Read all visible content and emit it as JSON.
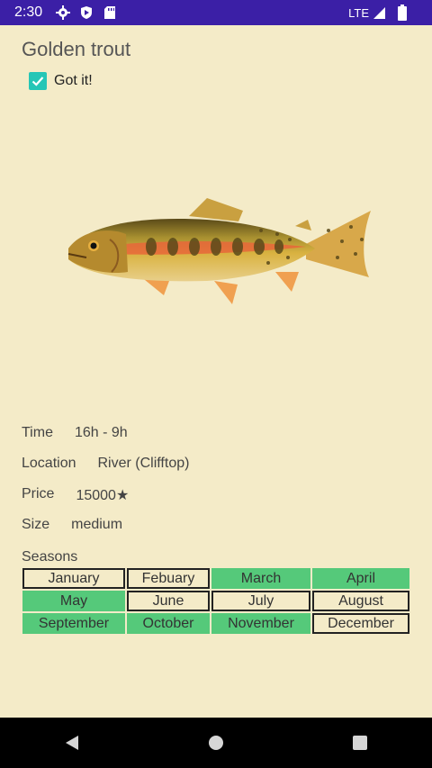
{
  "status_bar": {
    "time": "2:30",
    "network": "LTE"
  },
  "page": {
    "title": "Golden trout",
    "caught_label": "Got it!",
    "caught": true
  },
  "info": {
    "time_label": "Time",
    "time_value": "16h - 9h",
    "location_label": "Location",
    "location_value": "River (Clifftop)",
    "price_label": "Price",
    "price_value": "15000★",
    "size_label": "Size",
    "size_value": "medium"
  },
  "seasons": {
    "label": "Seasons",
    "months": [
      {
        "name": "January",
        "active": false
      },
      {
        "name": "Febuary",
        "active": false
      },
      {
        "name": "March",
        "active": true
      },
      {
        "name": "April",
        "active": true
      },
      {
        "name": "May",
        "active": true
      },
      {
        "name": "June",
        "active": false
      },
      {
        "name": "July",
        "active": false
      },
      {
        "name": "August",
        "active": false
      },
      {
        "name": "September",
        "active": true
      },
      {
        "name": "October",
        "active": true
      },
      {
        "name": "November",
        "active": true
      },
      {
        "name": "December",
        "active": false
      }
    ]
  },
  "colors": {
    "status_bar": "#3b1fa6",
    "background": "#f4ebc8",
    "checkbox": "#26c6b6",
    "season_active": "#55c97a"
  },
  "icons": {
    "status": [
      "gear-icon",
      "shield-icon",
      "sd-card-icon",
      "signal-icon",
      "battery-icon"
    ],
    "nav": [
      "back-icon",
      "home-icon",
      "recents-icon"
    ]
  }
}
